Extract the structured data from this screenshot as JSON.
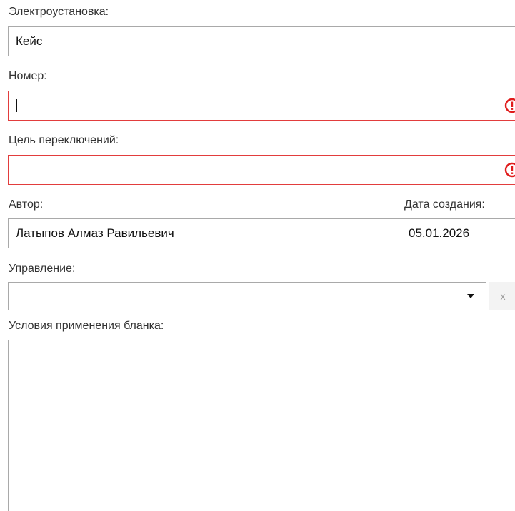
{
  "installation": {
    "label": "Электроустановка:",
    "value": "Кейс"
  },
  "number": {
    "label": "Номер:",
    "value": "",
    "error_icon": "exclamation-circle-icon"
  },
  "switch_purpose": {
    "label": "Цель переключений:",
    "value": "",
    "error_icon": "exclamation-circle-icon"
  },
  "author": {
    "label": "Автор:",
    "value": "Латыпов Алмаз Равильевич"
  },
  "created_date": {
    "label": "Дата создания:",
    "value": "05.01.2026"
  },
  "management": {
    "label": "Управление:",
    "selected": "",
    "clear_label": "x"
  },
  "conditions": {
    "label": "Условия применения бланка:",
    "value": ""
  },
  "colors": {
    "error": "#e23d3d",
    "border": "#a9a9a9"
  }
}
